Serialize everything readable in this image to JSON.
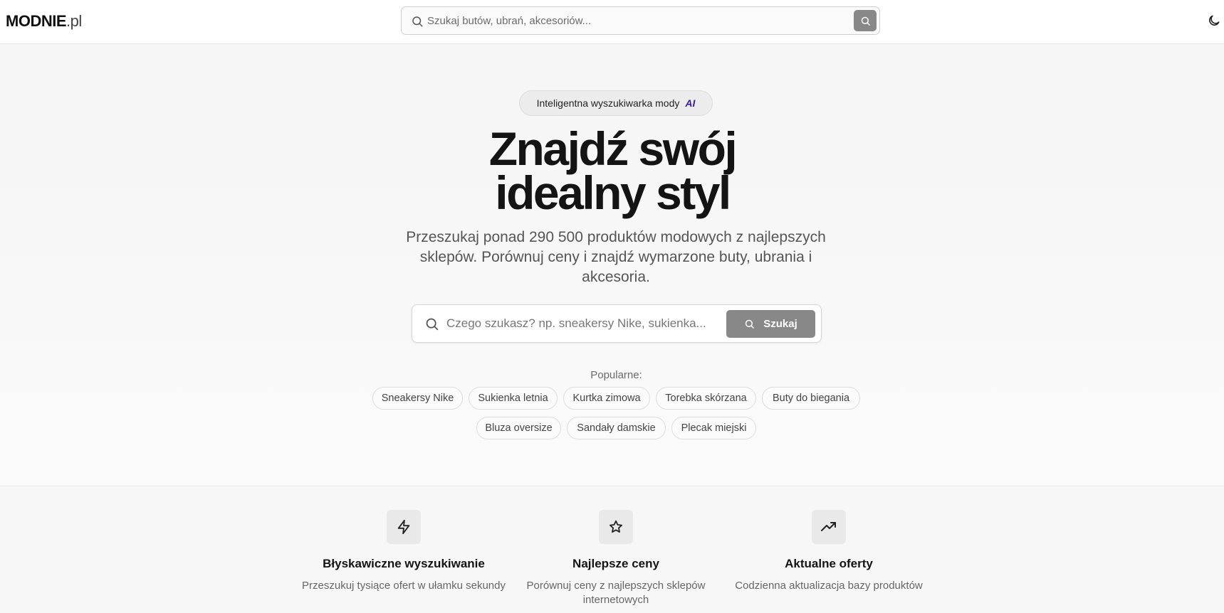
{
  "header": {
    "logo_brand": "MODNIE",
    "logo_tld": ".pl",
    "search_placeholder": "Szukaj butów, ubrań, akcesoriów...",
    "search_icon": "search-icon",
    "theme_icon": "moon-icon"
  },
  "hero": {
    "badge_text": "Inteligentna wyszukiwarka mody",
    "badge_ai": "AI",
    "title_line1": "Znajdź swój",
    "title_line2": "idealny styl",
    "subtitle": "Przeszukaj ponad 290 500 produktów modowych z najlepszych sklepów. Porównuj ceny i znajdź wymarzone buty, ubrania i akcesoria.",
    "search_placeholder": "Czego szukasz? np. sneakersy Nike, sukienka...",
    "search_button": "Szukaj",
    "popular_label": "Popularne:",
    "popular_row1": [
      "Sneakersy Nike",
      "Sukienka letnia",
      "Kurtka zimowa",
      "Torebka skórzana",
      "Buty do biegania"
    ],
    "popular_row2": [
      "Bluza oversize",
      "Sandały damskie",
      "Plecak miejski"
    ]
  },
  "features": [
    {
      "icon": "lightning-icon",
      "title": "Błyskawiczne wyszukiwanie",
      "desc": "Przeszukuj tysiące ofert w ułamku sekundy"
    },
    {
      "icon": "star-icon",
      "title": "Najlepsze ceny",
      "desc": "Porównuj ceny z najlepszych sklepów internetowych"
    },
    {
      "icon": "trending-up-icon",
      "title": "Aktualne oferty",
      "desc": "Codzienna aktualizacja bazy produktów"
    }
  ],
  "colors": {
    "button_gray": "#888888",
    "ai_accent": "#3b1d9a",
    "text_dark": "#141414"
  }
}
